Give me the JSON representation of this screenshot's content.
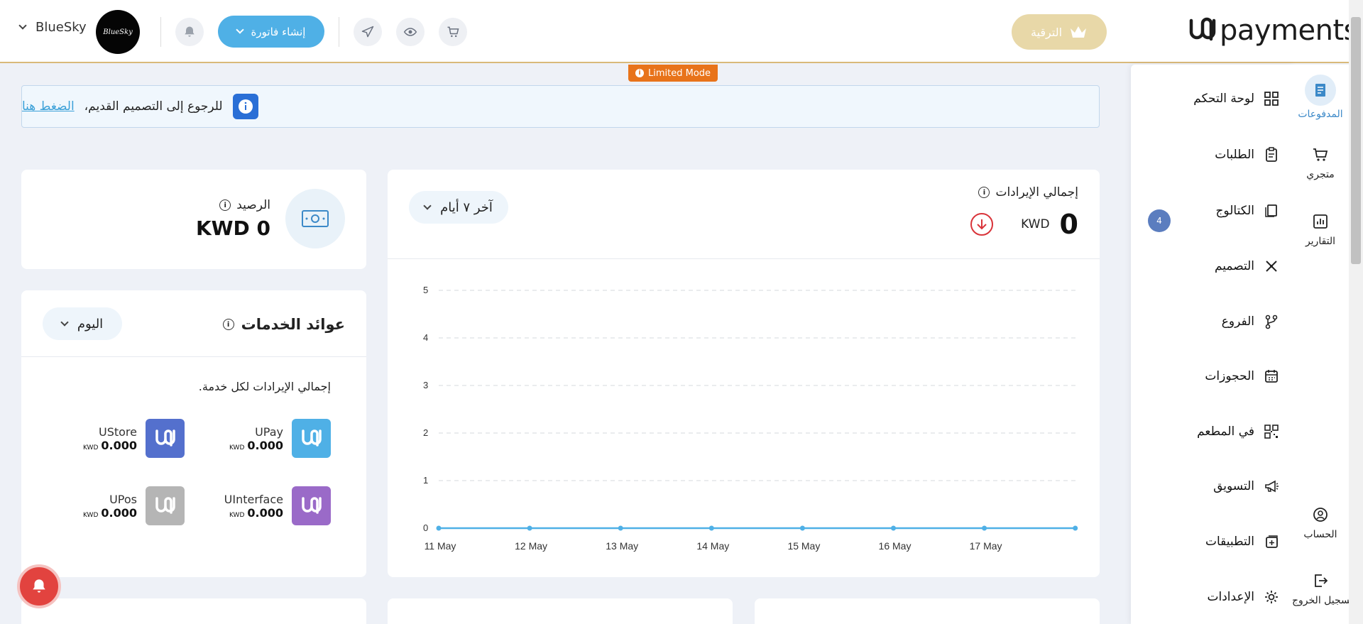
{
  "header": {
    "user_name": "BlueSky",
    "avatar_text": "BlueSky",
    "create_invoice_label": "إنشاء فاتورة",
    "upgrade_label": "الترقية",
    "logo_text": "payments"
  },
  "limited_mode": "Limited Mode",
  "banner": {
    "text": "للرجوع إلى التصميم القديم،",
    "link": "الضغط هنا"
  },
  "balance": {
    "title": "الرصيد",
    "value": "KWD 0"
  },
  "services": {
    "title": "عوائد الخدمات",
    "period": "اليوم",
    "subtitle": "إجمالي الإيرادات لكل خدمة.",
    "items": [
      {
        "name": "UPay",
        "value": "0.000",
        "currency": "KWD",
        "color": "#4fb0e6"
      },
      {
        "name": "UStore",
        "value": "0.000",
        "currency": "KWD",
        "color": "#5470cd"
      },
      {
        "name": "UInterface",
        "value": "0.000",
        "currency": "KWD",
        "color": "#9a6ac8"
      },
      {
        "name": "UPos",
        "value": "0.000",
        "currency": "KWD",
        "color": "#b5b5b5"
      }
    ]
  },
  "revenue": {
    "title": "إجمالي الإيرادات",
    "value": "0",
    "currency": "KWD",
    "period": "آخر ٧ أيام"
  },
  "chart_data": {
    "type": "line",
    "x": [
      "11 May",
      "12 May",
      "13 May",
      "14 May",
      "15 May",
      "16 May",
      "17 May",
      ""
    ],
    "series": [
      {
        "values": [
          0,
          0,
          0,
          0,
          0,
          0,
          0,
          0
        ],
        "color": "#4fb0e6"
      }
    ],
    "ylim": [
      0,
      5
    ],
    "yticks": [
      0,
      1,
      2,
      3,
      4,
      5
    ],
    "grid": true
  },
  "side_menu": [
    {
      "label": "لوحة التحكم",
      "icon": "grid-icon"
    },
    {
      "label": "الطلبات",
      "icon": "clipboard-icon",
      "badge": "4"
    },
    {
      "label": "الكتالوج",
      "icon": "catalog-icon"
    },
    {
      "label": "التصميم",
      "icon": "design-icon"
    },
    {
      "label": "الفروع",
      "icon": "branch-icon"
    },
    {
      "label": "الحجوزات",
      "icon": "calendar-icon"
    },
    {
      "label": "في المطعم",
      "icon": "qr-icon"
    },
    {
      "label": "التسويق",
      "icon": "megaphone-icon"
    },
    {
      "label": "التطبيقات",
      "icon": "apps-icon"
    },
    {
      "label": "الإعدادات",
      "icon": "gear-icon"
    }
  ],
  "rail": [
    {
      "label": "المدفوعات",
      "icon": "payments-icon"
    },
    {
      "label": "متجري",
      "icon": "cart-icon"
    },
    {
      "label": "التقارير",
      "icon": "chart-icon"
    },
    {
      "label": "الحساب",
      "icon": "account-icon"
    },
    {
      "label": "تسجيل الخروج",
      "icon": "logout-icon"
    }
  ]
}
